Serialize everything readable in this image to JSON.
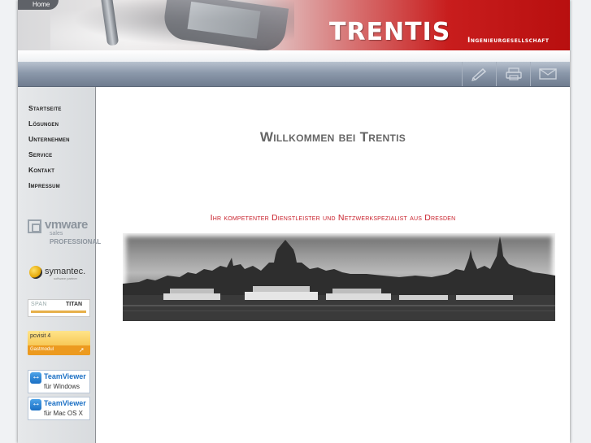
{
  "header": {
    "home_tab": "Home",
    "brand": "TRENTIS",
    "brand_sub": "Ingenieurgesellschaft"
  },
  "toolbar": {
    "icons": [
      "write-icon",
      "print-icon",
      "mail-icon"
    ]
  },
  "sidebar": {
    "nav": [
      {
        "label": "Startseite"
      },
      {
        "label": "Lösungen"
      },
      {
        "label": "Unternehmen"
      },
      {
        "label": "Service"
      },
      {
        "label": "Kontakt"
      },
      {
        "label": "Impressum"
      }
    ],
    "partners": {
      "vmware": {
        "word": "vmware",
        "sales": "sales",
        "pro": "PROFESSIONAL"
      },
      "symantec": {
        "word": "symantec.",
        "sub": "software partner"
      },
      "span_titan": {
        "left": "SPAN",
        "right": "TITAN"
      },
      "pcvisit": {
        "name": "pcvisit 4",
        "module": "Gastmodul"
      },
      "teamviewer_win": {
        "name": "TeamViewer",
        "sub": "für Windows"
      },
      "teamviewer_mac": {
        "name": "TeamViewer",
        "sub": "für Mac OS X"
      }
    }
  },
  "main": {
    "title": "Willkommen bei Trentis",
    "tagline": "Ihr kompetenter Dienstleister und Netzwerkspezialist aus Dresden"
  },
  "colors": {
    "brand_red": "#c81d1d",
    "tagline_red": "#c8202b",
    "toolbar_blue": "#8c99ab"
  }
}
